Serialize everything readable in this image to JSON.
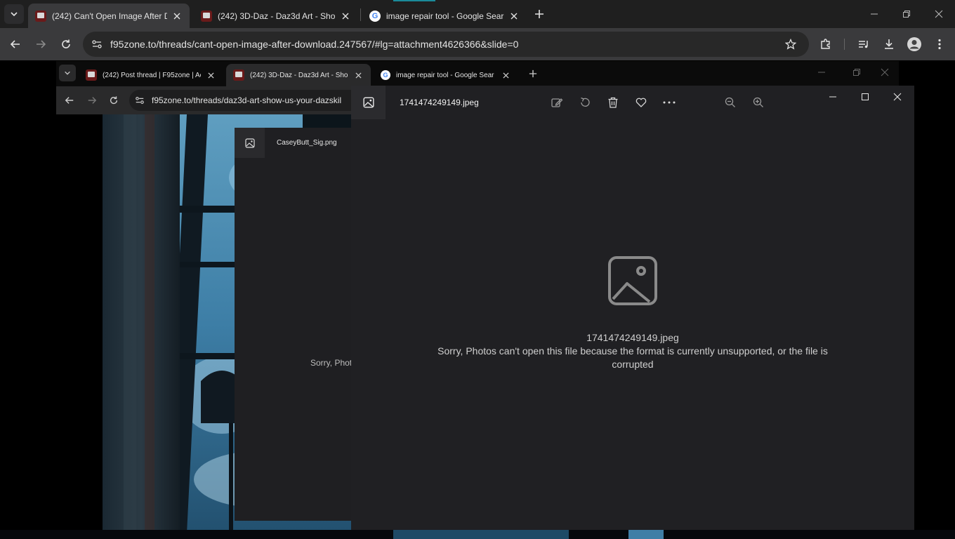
{
  "outer_browser": {
    "tabs": [
      {
        "title": "(242) Can't Open Image After D",
        "icon": "f95-favicon",
        "active": true
      },
      {
        "title": "(242) 3D-Daz - Daz3d Art - Sho",
        "icon": "f95-favicon",
        "active": false
      },
      {
        "title": "image repair tool - Google Sear",
        "icon": "google-favicon",
        "active": false
      }
    ],
    "url": "f95zone.to/threads/cant-open-image-after-download.247567/#lg=attachment4626366&slide=0"
  },
  "inner_browser": {
    "tabs": [
      {
        "title": "(242) Post thread | F95zone | Ac",
        "icon": "f95-favicon",
        "active": false
      },
      {
        "title": "(242) 3D-Daz - Daz3d Art - Sho",
        "icon": "f95-favicon",
        "active": true
      },
      {
        "title": "image repair tool - Google Sear",
        "icon": "google-favicon",
        "active": false
      }
    ],
    "url": "f95zone.to/threads/daz3d-art-show-us-your-dazskil"
  },
  "small_photos": {
    "filename": "CaseyButt_Sig.png",
    "error_partial": "Sorry, Phot"
  },
  "photos_app": {
    "filename": "1741474249149.jpeg",
    "error_filename": "1741474249149.jpeg",
    "error_message_line1": "Sorry, Photos can't open this file because the format is currently unsupported, or the file is",
    "error_message_line2": "corrupted",
    "toolbar_icons": [
      "edit-icon",
      "rotate-icon",
      "delete-icon",
      "favorite-icon",
      "more-icon",
      "zoom-out-icon",
      "zoom-in-icon"
    ]
  },
  "colors": {
    "tabbar_bg": "#1f1f1f",
    "toolbar_bg": "#3a3a3c",
    "photos_bg": "#202023",
    "accent": "#1a8a9a"
  }
}
